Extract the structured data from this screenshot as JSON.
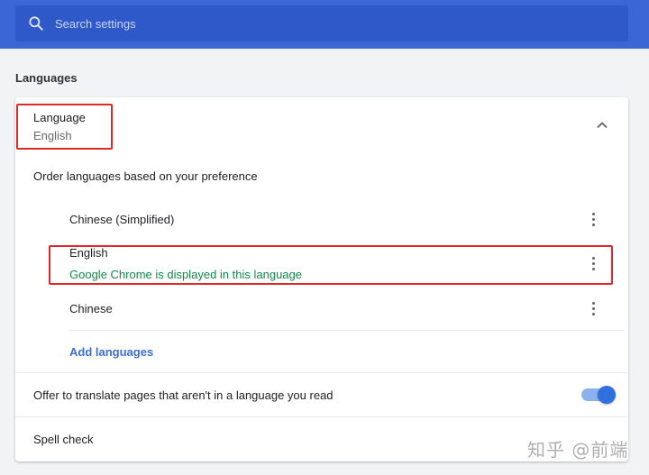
{
  "header": {
    "search": {
      "placeholder": "Search settings",
      "value": "",
      "icon": "search-icon"
    }
  },
  "section": {
    "title": "Languages"
  },
  "language": {
    "label": "Language",
    "value": "English",
    "expand_icon": "chevron-up-icon",
    "order_text": "Order languages based on your preference",
    "items": [
      {
        "name": "Chinese (Simplified)",
        "sub": ""
      },
      {
        "name": "English",
        "sub": "Google Chrome is displayed in this language"
      },
      {
        "name": "Chinese",
        "sub": ""
      }
    ],
    "more_icon": "more-vert-icon",
    "add_label": "Add languages"
  },
  "translate": {
    "label": "Offer to translate pages that aren't in a language you read",
    "enabled": true
  },
  "spellcheck": {
    "label": "Spell check"
  },
  "watermark": "知乎 @前端",
  "colors": {
    "header": "#3b67d6",
    "search_box": "#2f58c9",
    "accent": "#3b6fd2",
    "success_text": "#0f8a4a",
    "highlight_box": "#e0292b",
    "toggle_on": "#2f6fe0"
  }
}
